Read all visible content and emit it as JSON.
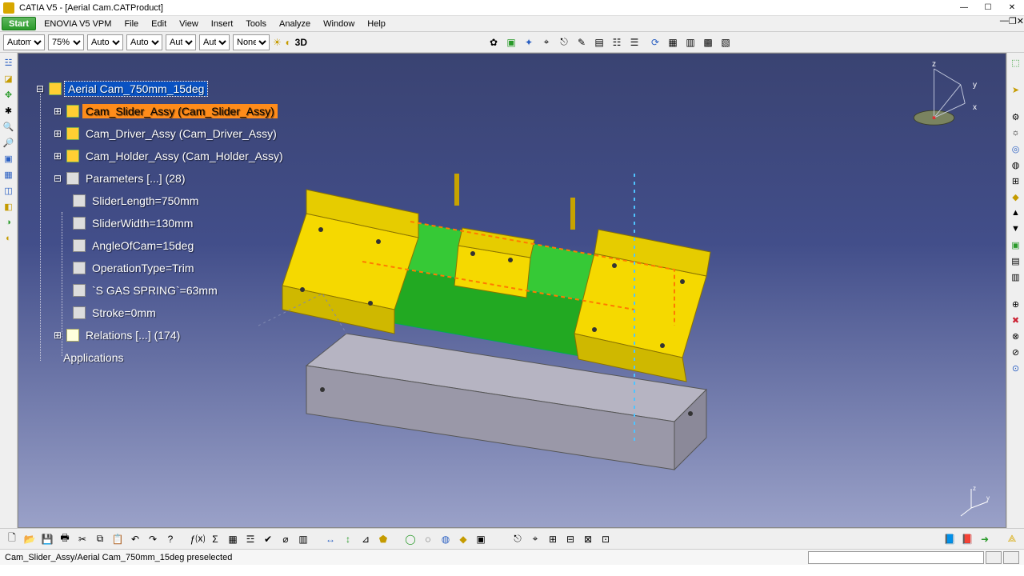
{
  "title": "CATIA V5 - [Aerial Cam.CATProduct]",
  "menu": {
    "start": "Start",
    "enovia": "ENOVIA V5 VPM",
    "file": "File",
    "edit": "Edit",
    "view": "View",
    "insert": "Insert",
    "tools": "Tools",
    "analyze": "Analyze",
    "window": "Window",
    "help": "Help"
  },
  "options": {
    "render": "Autom▾",
    "zoom": "75%",
    "auto1": "Auto",
    "auto2": "Auto",
    "aut3": "Aut",
    "aut4": "Aut",
    "none": "None",
    "threeD": "3D"
  },
  "tree": {
    "root": "Aerial Cam_750mm_15deg",
    "n1": "Cam_Slider_Assy (Cam_Slider_Assy)",
    "n2": "Cam_Driver_Assy (Cam_Driver_Assy)",
    "n3": "Cam_Holder_Assy (Cam_Holder_Assy)",
    "params_label": "Parameters [...] (28)",
    "p1": "SliderLength=750mm",
    "p2": "SliderWidth=130mm",
    "p3": "AngleOfCam=15deg",
    "p4": "OperationType=Trim",
    "p5": "`S GAS SPRING`=63mm",
    "p6": "Stroke=0mm",
    "relations": "Relations [...] (174)",
    "apps": "Applications"
  },
  "compass": {
    "x": "x",
    "y": "y",
    "z": "z"
  },
  "status": {
    "message": "Cam_Slider_Assy/Aerial Cam_750mm_15deg preselected"
  },
  "colors": {
    "accent_orange": "#ff8c1a",
    "accent_blue": "#0a52c2",
    "viewport_top": "#3a4372",
    "viewport_bottom": "#9aa1c8"
  }
}
